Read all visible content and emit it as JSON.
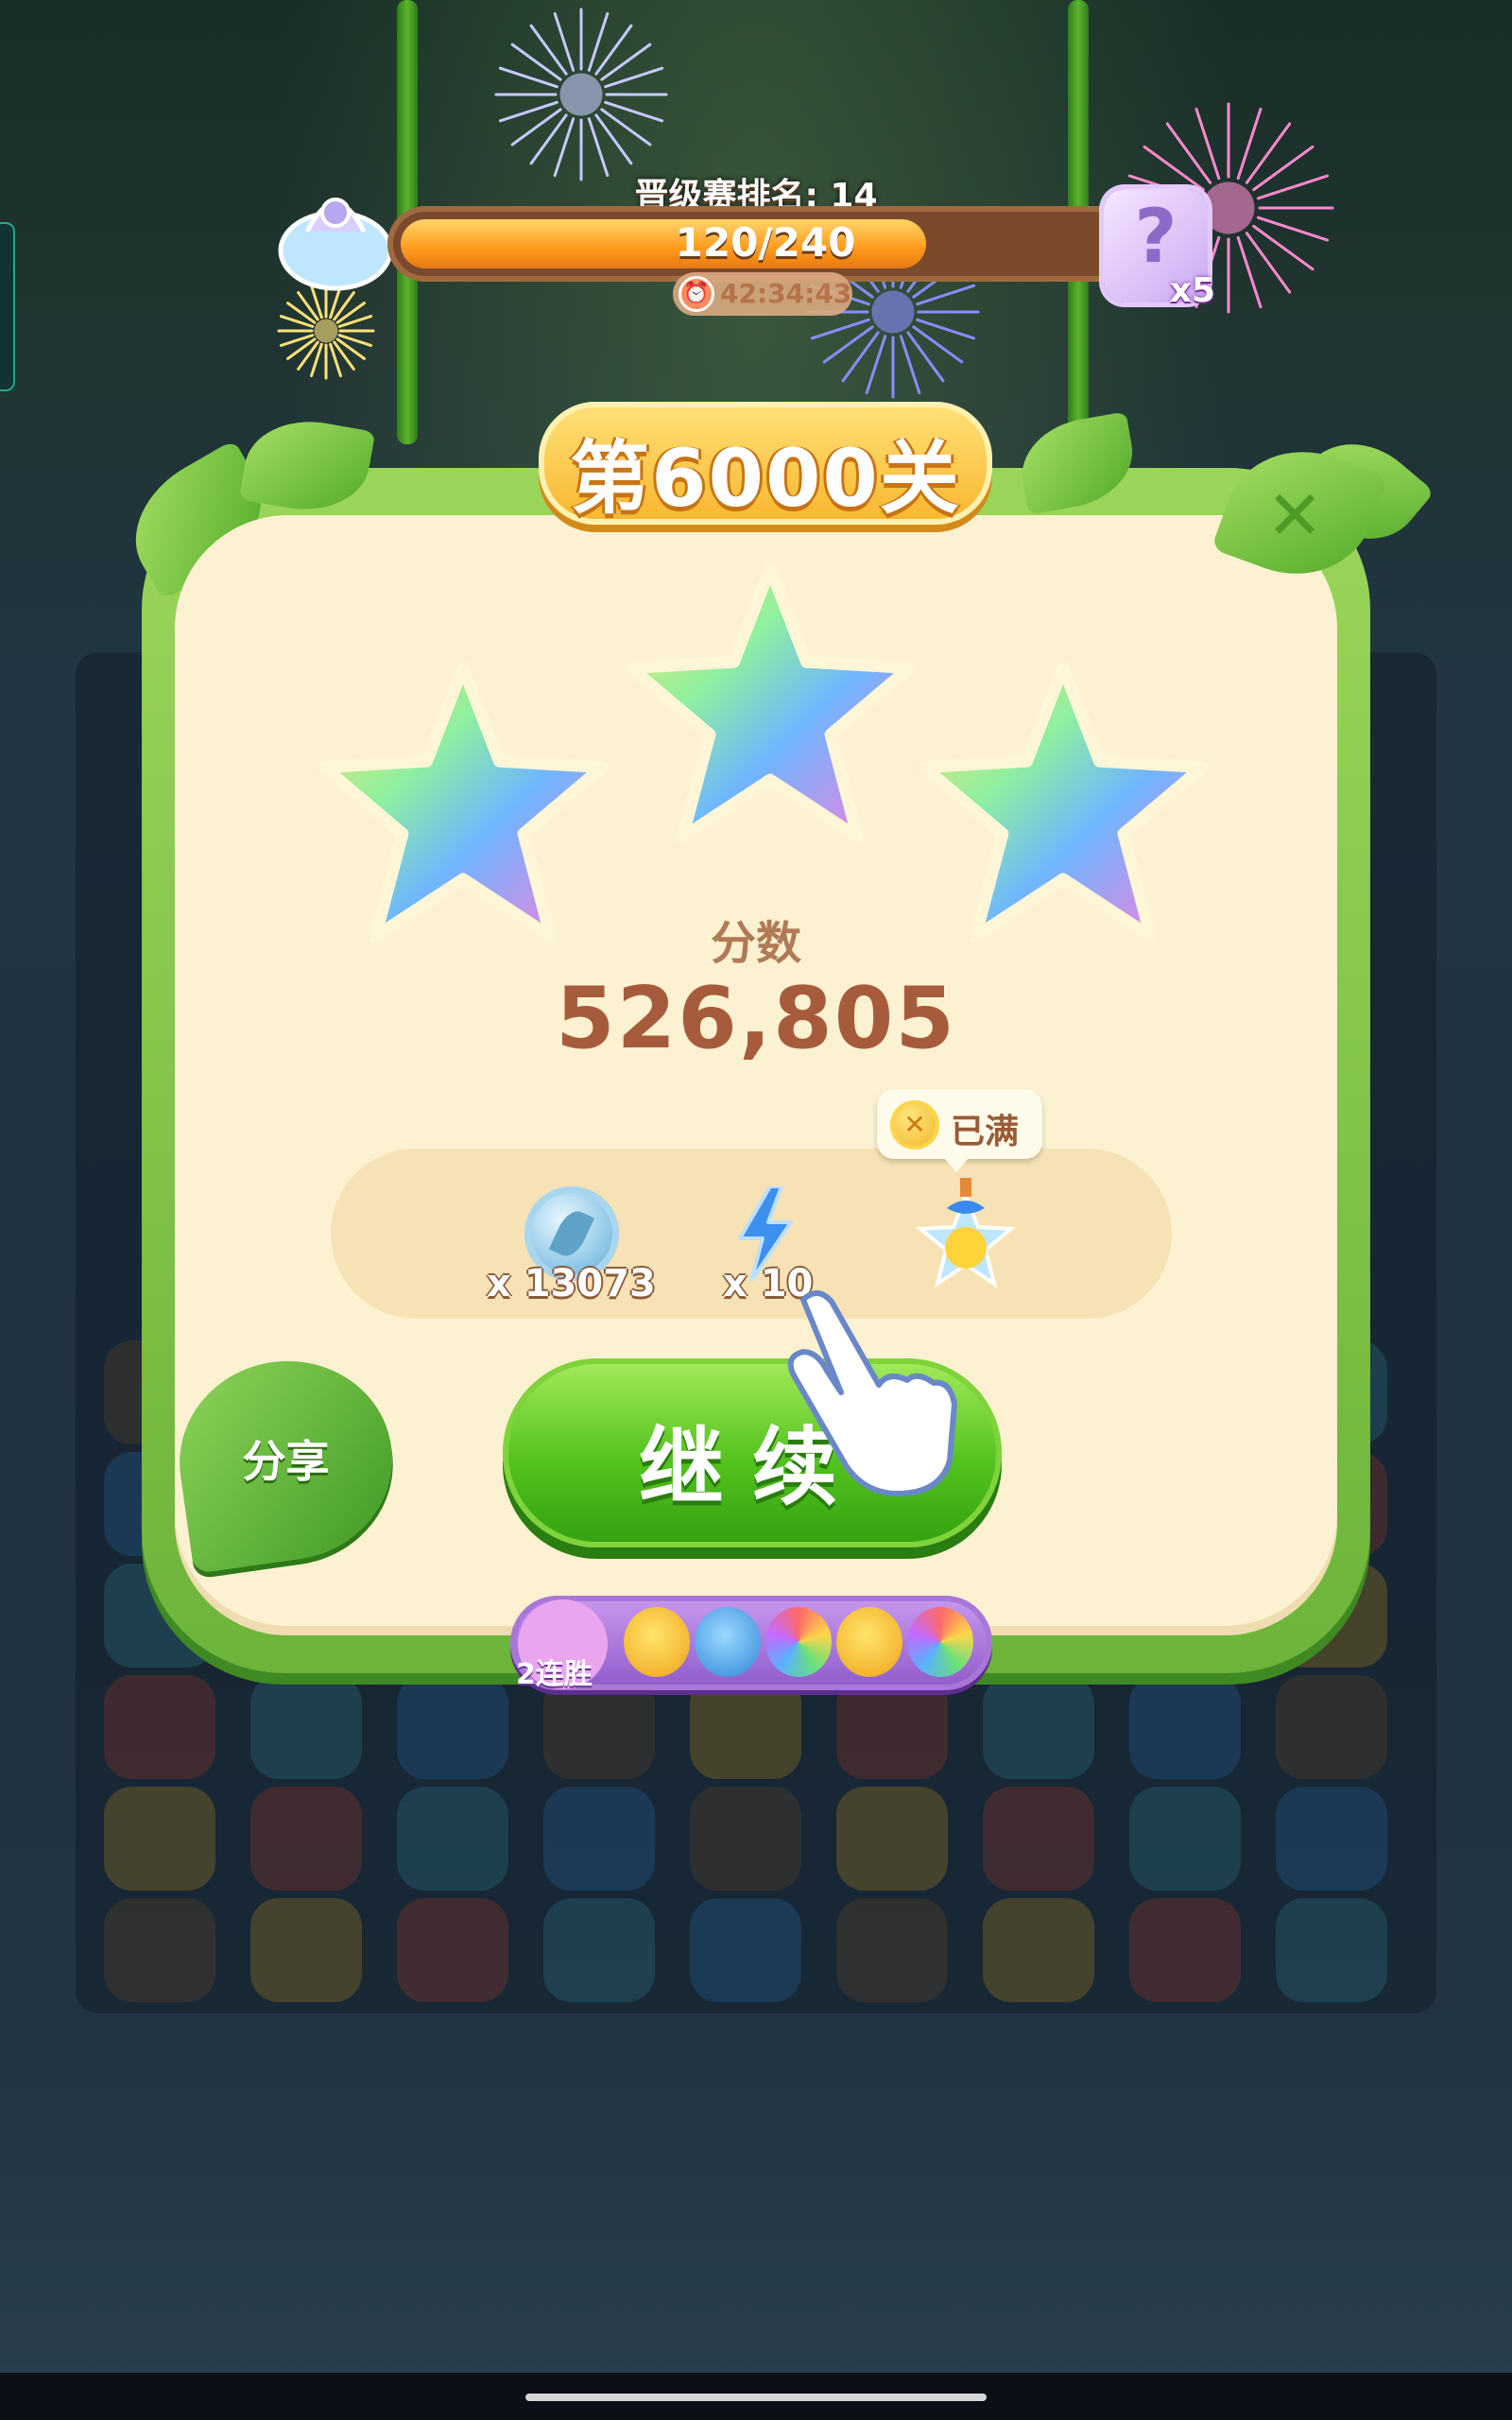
{
  "top_bar": {
    "rank_label": "晋级赛排名: 14",
    "progress_text": "120/240",
    "progress_fraction": 0.5,
    "timer_text": "42:34:43",
    "chest_count": "x5"
  },
  "panel": {
    "level_title": "第6000关",
    "stars_earned": 3,
    "score_label": "分数",
    "score_value": "526,805"
  },
  "rewards": {
    "items": [
      {
        "icon": "silver-leaf-coin-icon",
        "count": "x 13073"
      },
      {
        "icon": "lightning-bolt-icon",
        "count": "x 10"
      },
      {
        "icon": "star-gift-jar-icon",
        "count": ""
      }
    ],
    "full_tip": "已满"
  },
  "buttons": {
    "share": "分享",
    "continue": "继续"
  },
  "streak": {
    "label": "2连胜",
    "icons": [
      "chick-icon",
      "blue-bear-icon",
      "rainbow-owl-icon",
      "chick-icon",
      "rainbow-owl-icon"
    ]
  },
  "colors": {
    "panel_green": "#6cb43a",
    "panel_cream": "#fcf2d2",
    "score_brown": "#a65c3c",
    "continue_green": "#52c21e",
    "streak_purple": "#8d5ac9"
  }
}
